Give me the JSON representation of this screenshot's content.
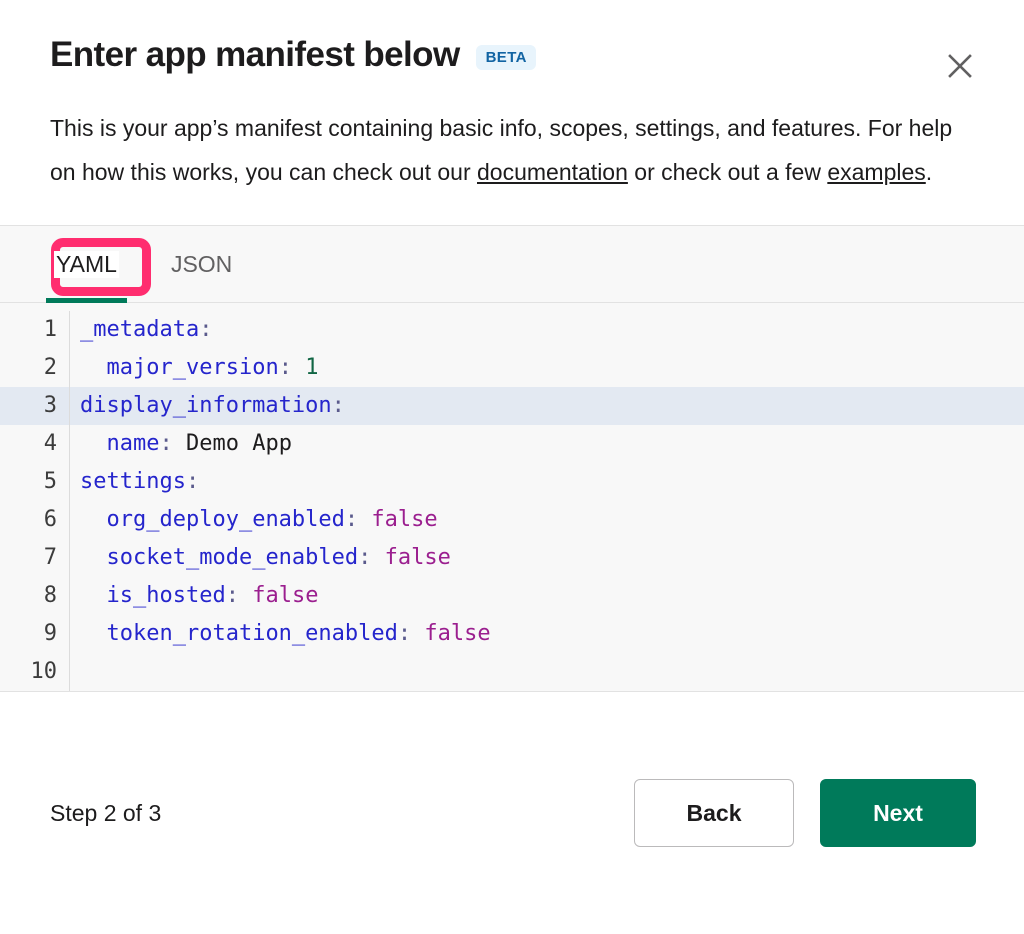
{
  "modal": {
    "title": "Enter app manifest below",
    "badge": "BETA",
    "close_icon": "close-icon",
    "description": {
      "part1": "This is your app’s manifest containing basic info, scopes, settings, and features. For help on how this works, you can check out our ",
      "link1": "documentation",
      "part2": " or check out a few ",
      "link2": "examples",
      "part3": "."
    }
  },
  "tabs": [
    {
      "label": "YAML",
      "active": true
    },
    {
      "label": "JSON",
      "active": false
    }
  ],
  "editor": {
    "language": "YAML",
    "active_line": 3,
    "lines": [
      {
        "num": "1",
        "tokens": [
          {
            "t": "_metadata",
            "c": "key"
          },
          {
            "t": ":",
            "c": "punct"
          }
        ]
      },
      {
        "num": "2",
        "tokens": [
          {
            "t": "  ",
            "c": "str"
          },
          {
            "t": "major_version",
            "c": "key"
          },
          {
            "t": ": ",
            "c": "punct"
          },
          {
            "t": "1",
            "c": "num"
          }
        ]
      },
      {
        "num": "3",
        "tokens": [
          {
            "t": "display_information",
            "c": "key"
          },
          {
            "t": ":",
            "c": "punct"
          }
        ]
      },
      {
        "num": "4",
        "tokens": [
          {
            "t": "  ",
            "c": "str"
          },
          {
            "t": "name",
            "c": "key"
          },
          {
            "t": ": ",
            "c": "punct"
          },
          {
            "t": "Demo App",
            "c": "str"
          }
        ]
      },
      {
        "num": "5",
        "tokens": [
          {
            "t": "settings",
            "c": "key"
          },
          {
            "t": ":",
            "c": "punct"
          }
        ]
      },
      {
        "num": "6",
        "tokens": [
          {
            "t": "  ",
            "c": "str"
          },
          {
            "t": "org_deploy_enabled",
            "c": "key"
          },
          {
            "t": ": ",
            "c": "punct"
          },
          {
            "t": "false",
            "c": "bool"
          }
        ]
      },
      {
        "num": "7",
        "tokens": [
          {
            "t": "  ",
            "c": "str"
          },
          {
            "t": "socket_mode_enabled",
            "c": "key"
          },
          {
            "t": ": ",
            "c": "punct"
          },
          {
            "t": "false",
            "c": "bool"
          }
        ]
      },
      {
        "num": "8",
        "tokens": [
          {
            "t": "  ",
            "c": "str"
          },
          {
            "t": "is_hosted",
            "c": "key"
          },
          {
            "t": ": ",
            "c": "punct"
          },
          {
            "t": "false",
            "c": "bool"
          }
        ]
      },
      {
        "num": "9",
        "tokens": [
          {
            "t": "  ",
            "c": "str"
          },
          {
            "t": "token_rotation_enabled",
            "c": "key"
          },
          {
            "t": ": ",
            "c": "punct"
          },
          {
            "t": "false",
            "c": "bool"
          }
        ]
      },
      {
        "num": "10",
        "tokens": []
      }
    ]
  },
  "footer": {
    "step_text": "Step 2 of 3",
    "back_label": "Back",
    "next_label": "Next"
  },
  "colors": {
    "accent_green": "#007a5a",
    "focus_pink": "#ff2d6f",
    "badge_bg": "#e8f4fc",
    "badge_text": "#1264a3",
    "active_line": "#e3e9f2",
    "editor_bg": "#f8f8f8"
  }
}
